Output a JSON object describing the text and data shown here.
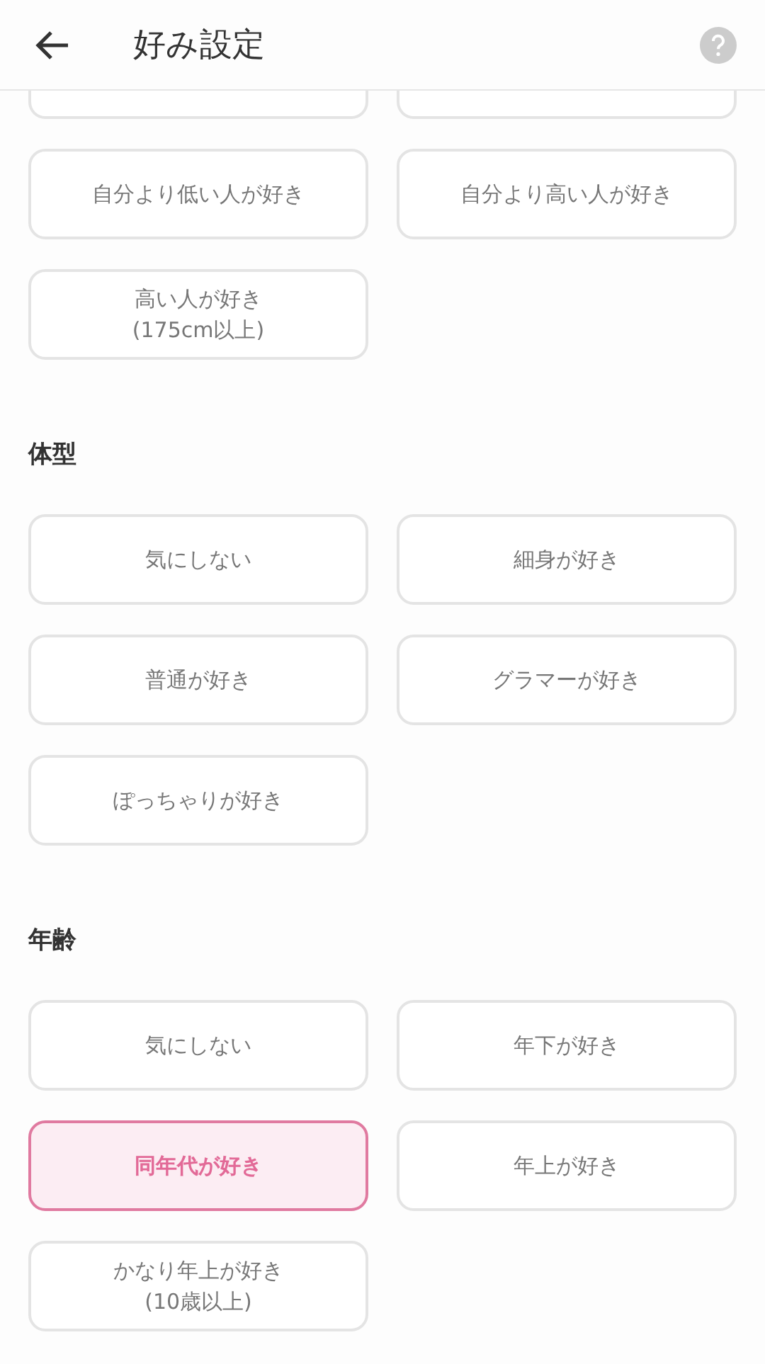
{
  "header": {
    "title": "好み設定"
  },
  "sections": [
    {
      "partial_top_row": true,
      "options": [
        {
          "label": "自分より低い人が好き",
          "selected": false
        },
        {
          "label": "自分より高い人が好き",
          "selected": false
        },
        {
          "label": "高い人が好き\n(175cm以上)",
          "selected": false
        }
      ]
    },
    {
      "heading": "体型",
      "options": [
        {
          "label": "気にしない",
          "selected": false
        },
        {
          "label": "細身が好き",
          "selected": false
        },
        {
          "label": "普通が好き",
          "selected": false
        },
        {
          "label": "グラマーが好き",
          "selected": false
        },
        {
          "label": "ぽっちゃりが好き",
          "selected": false
        }
      ]
    },
    {
      "heading": "年齢",
      "options": [
        {
          "label": "気にしない",
          "selected": false
        },
        {
          "label": "年下が好き",
          "selected": false
        },
        {
          "label": "同年代が好き",
          "selected": true
        },
        {
          "label": "年上が好き",
          "selected": false
        },
        {
          "label": "かなり年上が好き\n(10歳以上)",
          "selected": false
        }
      ]
    }
  ]
}
